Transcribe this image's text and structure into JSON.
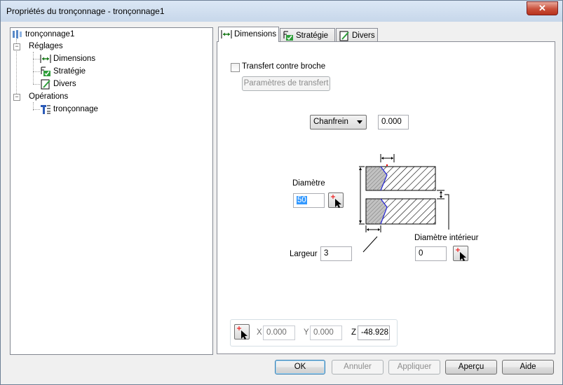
{
  "window": {
    "title": "Propriétés du tronçonnage - tronçonnage1",
    "close_glyph": "✕"
  },
  "tree": {
    "root": "tronçonnage1",
    "reglages": "Réglages",
    "dimensions": "Dimensions",
    "strategie": "Stratégie",
    "divers": "Divers",
    "operations": "Opérations",
    "troncon": "tronçonnage"
  },
  "tabs": [
    {
      "label": "Dimensions",
      "icon": "dimensions-icon",
      "active": true
    },
    {
      "label": "Stratégie",
      "icon": "strategy-icon",
      "active": false
    },
    {
      "label": "Divers",
      "icon": "misc-edit-icon",
      "active": false
    }
  ],
  "dimensions": {
    "transfert_label": "Transfert contre broche",
    "transfert_checked": false,
    "params_button": "Paramètres de transfert",
    "chamfer_select": "Chanfrein",
    "chamfer_value": "0.000",
    "diametre_label": "Diamètre",
    "diametre_value": "50",
    "largeur_label": "Largeur",
    "largeur_value": "3",
    "diam_int_label": "Diamètre intérieur",
    "diam_int_value": "0",
    "coords": {
      "x_label": "X",
      "x_value": "0.000",
      "y_label": "Y",
      "y_value": "0.000",
      "z_label": "Z",
      "z_value": "-48.928"
    }
  },
  "buttons": {
    "ok": "OK",
    "annuler": "Annuler",
    "appliquer": "Appliquer",
    "apercu": "Aperçu",
    "aide": "Aide"
  },
  "colors": {
    "accent": "#3399ff",
    "hatch": "#000000",
    "chamfer_fill": "#b4b4b4",
    "profile_line": "#2e2ee0"
  }
}
